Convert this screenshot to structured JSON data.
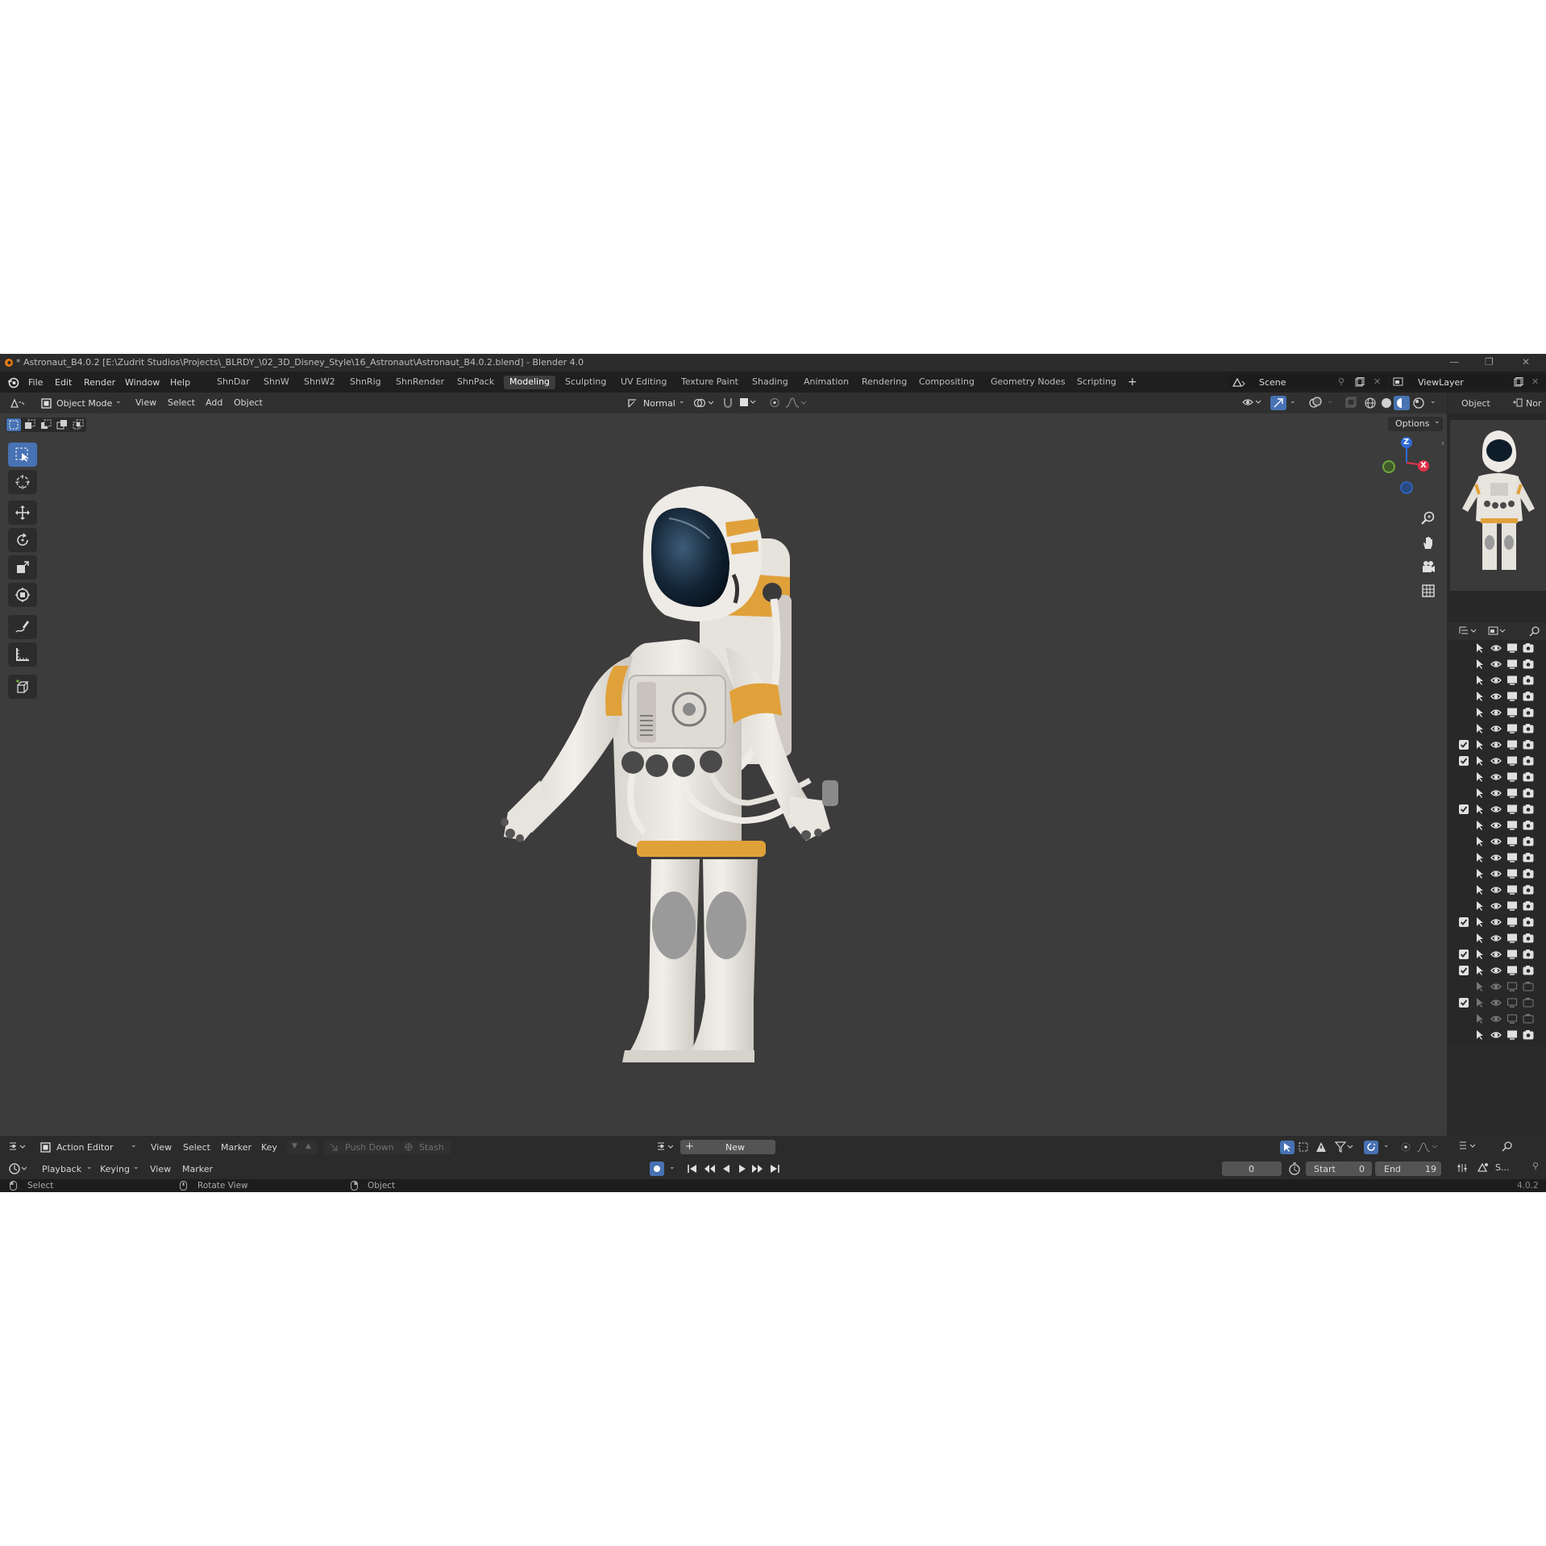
{
  "titlebar": {
    "title": "* Astronaut_B4.0.2 [E:\\Zudrit Studios\\Projects\\_BLRDY_\\02_3D_Disney_Style\\16_Astronaut\\Astronaut_B4.0.2.blend] - Blender 4.0",
    "minimize": "—",
    "restore": "❐",
    "close": "✕"
  },
  "menu": {
    "items": [
      "File",
      "Edit",
      "Render",
      "Window",
      "Help"
    ],
    "workspaces": [
      "ShnDar",
      "ShnW",
      "ShnW2",
      "ShnRig",
      "ShnRender",
      "ShnPack",
      "Modeling",
      "Sculpting",
      "UV Editing",
      "Texture Paint",
      "Shading",
      "Animation",
      "Rendering",
      "Compositing",
      "Geometry Nodes",
      "Scripting"
    ],
    "active_workspace": "Modeling",
    "add_workspace": "+",
    "scene": "Scene",
    "view_layer": "ViewLayer"
  },
  "viewport_header": {
    "mode": "Object Mode",
    "menus": [
      "View",
      "Select",
      "Add",
      "Object"
    ],
    "orientation": "Normal",
    "options": "Options"
  },
  "properties_header": {
    "tab_object": "Object",
    "tab_partial": "Nor"
  },
  "gizmo": {
    "z": "Z",
    "x": "X",
    "z_color": "#2e6bd6",
    "x_color": "#e0334a",
    "y_color": "#6ea83a"
  },
  "accent_color": "#4772b3",
  "outliner_rows": [
    {
      "check": false,
      "faded": false
    },
    {
      "check": false,
      "faded": false
    },
    {
      "check": false,
      "faded": false
    },
    {
      "check": false,
      "faded": false
    },
    {
      "check": false,
      "faded": false
    },
    {
      "check": false,
      "faded": false
    },
    {
      "check": true,
      "faded": false
    },
    {
      "check": true,
      "faded": false
    },
    {
      "check": false,
      "faded": false
    },
    {
      "check": false,
      "faded": false
    },
    {
      "check": true,
      "faded": false
    },
    {
      "check": false,
      "faded": false
    },
    {
      "check": false,
      "faded": false
    },
    {
      "check": false,
      "faded": false
    },
    {
      "check": false,
      "faded": false
    },
    {
      "check": false,
      "faded": false
    },
    {
      "check": false,
      "faded": false
    },
    {
      "check": true,
      "faded": false
    },
    {
      "check": false,
      "faded": false
    },
    {
      "check": true,
      "faded": false
    },
    {
      "check": true,
      "faded": false
    },
    {
      "check": false,
      "faded": true
    },
    {
      "check": true,
      "faded": true
    },
    {
      "check": false,
      "faded": true
    },
    {
      "check": false,
      "faded": false
    }
  ],
  "action_editor": {
    "editor": "Action Editor",
    "menus": [
      "View",
      "Select",
      "Marker",
      "Key"
    ],
    "push_down": "Push Down",
    "stash": "Stash",
    "new_button": "New"
  },
  "timeline": {
    "menus": [
      "Playback",
      "Keying",
      "View",
      "Marker"
    ],
    "current_frame": "0",
    "start_label": "Start",
    "start_value": "0",
    "end_label": "End",
    "end_value": "19",
    "scene_short": "S..."
  },
  "statusbar": {
    "select": "Select",
    "rotate": "Rotate View",
    "object": "Object",
    "version": "4.0.2"
  }
}
